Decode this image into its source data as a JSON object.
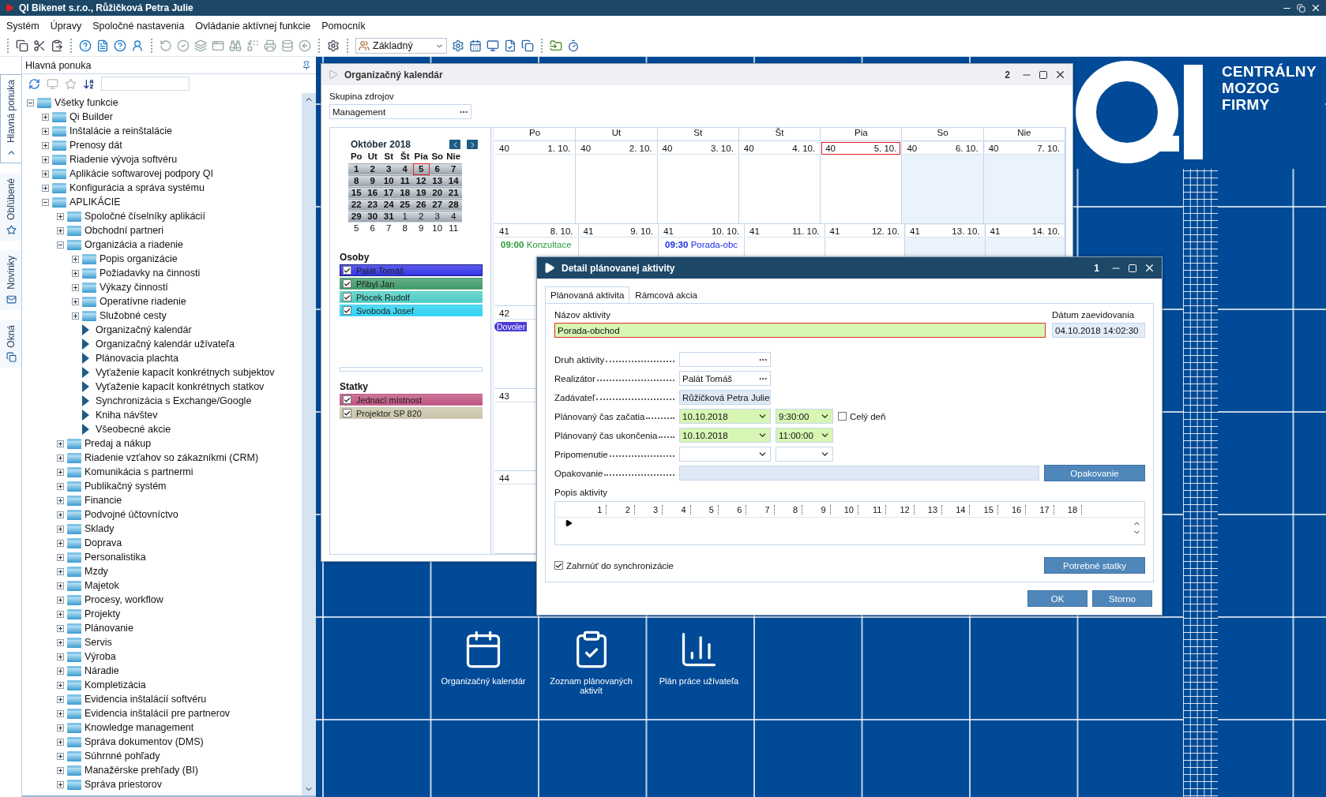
{
  "window": {
    "title": "QI  Bikenet s.r.o., Růžičková Petra Julie"
  },
  "menu": [
    "Systém",
    "Úpravy",
    "Spoločné nastavenia",
    "Ovládanie aktívnej funkcie",
    "Pomocník"
  ],
  "toolbar": {
    "profile": "Základný"
  },
  "sidebar": {
    "tabs": [
      {
        "label": "Hlavná ponuka",
        "selected": true
      },
      {
        "label": "Obľúbené",
        "selected": false
      },
      {
        "label": "Novinky",
        "selected": false
      },
      {
        "label": "Okná",
        "selected": false
      }
    ],
    "title": "Hlavná ponuka",
    "tree": [
      {
        "label": "Všetky funkcie",
        "kind": "folder",
        "expanded": true,
        "children": [
          {
            "label": "Qi Builder",
            "kind": "folder",
            "expanded": false
          },
          {
            "label": "Inštalácie a reinštalácie",
            "kind": "folder",
            "expanded": false
          },
          {
            "label": "Prenosy dát",
            "kind": "folder",
            "expanded": false
          },
          {
            "label": "Riadenie vývoja softvéru",
            "kind": "folder",
            "expanded": false
          },
          {
            "label": "Aplikácie softwarovej podpory QI",
            "kind": "folder",
            "expanded": false
          },
          {
            "label": "Konfigurácia a správa systému",
            "kind": "folder",
            "expanded": false
          },
          {
            "label": "APLIKÁCIE",
            "kind": "folder",
            "expanded": true,
            "children": [
              {
                "label": "Spoločné číselníky aplikácií",
                "kind": "folder",
                "expanded": false
              },
              {
                "label": "Obchodní partneri",
                "kind": "folder",
                "expanded": false
              },
              {
                "label": "Organizácia a riadenie",
                "kind": "folder",
                "expanded": true,
                "children": [
                  {
                    "label": "Popis organizácie",
                    "kind": "folder",
                    "expanded": false
                  },
                  {
                    "label": "Požiadavky na činnosti",
                    "kind": "folder",
                    "expanded": false
                  },
                  {
                    "label": "Výkazy činností",
                    "kind": "folder",
                    "expanded": false
                  },
                  {
                    "label": "Operatívne riadenie",
                    "kind": "folder",
                    "expanded": false
                  },
                  {
                    "label": "Služobné cesty",
                    "kind": "folder",
                    "expanded": false
                  },
                  {
                    "label": "Organizačný kalendár",
                    "kind": "function"
                  },
                  {
                    "label": "Organizačný kalendár užívateľa",
                    "kind": "function"
                  },
                  {
                    "label": "Plánovacia plachta",
                    "kind": "function"
                  },
                  {
                    "label": "Vyťaženie kapacít konkrétnych subjektov",
                    "kind": "function"
                  },
                  {
                    "label": "Vyťaženie kapacít konkrétnych statkov",
                    "kind": "function"
                  },
                  {
                    "label": "Synchronizácia s Exchange/Google",
                    "kind": "function"
                  },
                  {
                    "label": "Kniha návštev",
                    "kind": "function"
                  },
                  {
                    "label": "Všeobecné akcie",
                    "kind": "function"
                  }
                ]
              },
              {
                "label": "Predaj a nákup",
                "kind": "folder",
                "expanded": false
              },
              {
                "label": "Riadenie vzťahov so zákazníkmi (CRM)",
                "kind": "folder",
                "expanded": false
              },
              {
                "label": "Komunikácia s partnermi",
                "kind": "folder",
                "expanded": false
              },
              {
                "label": "Publikačný systém",
                "kind": "folder",
                "expanded": false
              },
              {
                "label": "Financie",
                "kind": "folder",
                "expanded": false
              },
              {
                "label": "Podvojné účtovníctvo",
                "kind": "folder",
                "expanded": false
              },
              {
                "label": "Sklady",
                "kind": "folder",
                "expanded": false
              },
              {
                "label": "Doprava",
                "kind": "folder",
                "expanded": false
              },
              {
                "label": "Personalistika",
                "kind": "folder",
                "expanded": false
              },
              {
                "label": "Mzdy",
                "kind": "folder",
                "expanded": false
              },
              {
                "label": "Majetok",
                "kind": "folder",
                "expanded": false
              },
              {
                "label": "Procesy, workflow",
                "kind": "folder",
                "expanded": false
              },
              {
                "label": "Projekty",
                "kind": "folder",
                "expanded": false
              },
              {
                "label": "Plánovanie",
                "kind": "folder",
                "expanded": false
              },
              {
                "label": "Servis",
                "kind": "folder",
                "expanded": false
              },
              {
                "label": "Výroba",
                "kind": "folder",
                "expanded": false
              },
              {
                "label": "Náradie",
                "kind": "folder",
                "expanded": false
              },
              {
                "label": "Kompletizácia",
                "kind": "folder",
                "expanded": false
              },
              {
                "label": "Evidencia inštalácií softvéru",
                "kind": "folder",
                "expanded": false
              },
              {
                "label": "Evidencia inštalácií pre partnerov",
                "kind": "folder",
                "expanded": false
              },
              {
                "label": "Knowledge management",
                "kind": "folder",
                "expanded": false
              },
              {
                "label": "Správa dokumentov (DMS)",
                "kind": "folder",
                "expanded": false
              },
              {
                "label": "Súhrnné pohľady",
                "kind": "folder",
                "expanded": false
              },
              {
                "label": "Manažérske prehľady (BI)",
                "kind": "folder",
                "expanded": false
              },
              {
                "label": "Správa priestorov",
                "kind": "folder",
                "expanded": false
              }
            ]
          }
        ]
      }
    ]
  },
  "calendar_window": {
    "title": "Organizačný kalendár",
    "number": "2",
    "group_label": "Skupina zdrojov",
    "group_value": "Management",
    "mini_calendar": {
      "title": "Október 2018",
      "weekdays": [
        "Po",
        "Ut",
        "St",
        "Št",
        "Pia",
        "So",
        "Nie"
      ],
      "weeks": [
        [
          {
            "day": "1",
            "in_month": true,
            "today": false
          },
          {
            "day": "2",
            "in_month": true,
            "today": false
          },
          {
            "day": "3",
            "in_month": true,
            "today": false
          },
          {
            "day": "4",
            "in_month": true,
            "today": false
          },
          {
            "day": "5",
            "in_month": true,
            "today": true
          },
          {
            "day": "6",
            "in_month": true,
            "today": false
          },
          {
            "day": "7",
            "in_month": true,
            "today": false
          }
        ],
        [
          {
            "day": "8",
            "in_month": true,
            "today": false
          },
          {
            "day": "9",
            "in_month": true,
            "today": false
          },
          {
            "day": "10",
            "in_month": true,
            "today": false
          },
          {
            "day": "11",
            "in_month": true,
            "today": false
          },
          {
            "day": "12",
            "in_month": true,
            "today": false
          },
          {
            "day": "13",
            "in_month": true,
            "today": false
          },
          {
            "day": "14",
            "in_month": true,
            "today": false
          }
        ],
        [
          {
            "day": "15",
            "in_month": true,
            "today": false
          },
          {
            "day": "16",
            "in_month": true,
            "today": false
          },
          {
            "day": "17",
            "in_month": true,
            "today": false
          },
          {
            "day": "18",
            "in_month": true,
            "today": false
          },
          {
            "day": "19",
            "in_month": true,
            "today": false
          },
          {
            "day": "20",
            "in_month": true,
            "today": false
          },
          {
            "day": "21",
            "in_month": true,
            "today": false
          }
        ],
        [
          {
            "day": "22",
            "in_month": true,
            "today": false
          },
          {
            "day": "23",
            "in_month": true,
            "today": false
          },
          {
            "day": "24",
            "in_month": true,
            "today": false
          },
          {
            "day": "25",
            "in_month": true,
            "today": false
          },
          {
            "day": "26",
            "in_month": true,
            "today": false
          },
          {
            "day": "27",
            "in_month": true,
            "today": false
          },
          {
            "day": "28",
            "in_month": true,
            "today": false
          }
        ],
        [
          {
            "day": "29",
            "in_month": true,
            "today": false
          },
          {
            "day": "30",
            "in_month": true,
            "today": false
          },
          {
            "day": "31",
            "in_month": true,
            "today": false
          },
          {
            "day": "1",
            "in_month": false,
            "today": false
          },
          {
            "day": "2",
            "in_month": false,
            "today": false
          },
          {
            "day": "3",
            "in_month": false,
            "today": false
          },
          {
            "day": "4",
            "in_month": false,
            "today": false
          }
        ],
        [
          {
            "day": "5",
            "in_month": false,
            "today": false
          },
          {
            "day": "6",
            "in_month": false,
            "today": false
          },
          {
            "day": "7",
            "in_month": false,
            "today": false
          },
          {
            "day": "8",
            "in_month": false,
            "today": false
          },
          {
            "day": "9",
            "in_month": false,
            "today": false
          },
          {
            "day": "10",
            "in_month": false,
            "today": false
          },
          {
            "day": "11",
            "in_month": false,
            "today": false
          }
        ]
      ]
    },
    "people_label": "Osoby",
    "people": [
      {
        "name": "Palát Tomáš",
        "checked": true,
        "selected": true,
        "color": "#3434e8"
      },
      {
        "name": "Přibyl Jan",
        "checked": true,
        "selected": false,
        "color": "#3f9a68"
      },
      {
        "name": "Plocek Rudolf",
        "checked": true,
        "selected": false,
        "color": "#4ccdc4"
      },
      {
        "name": "Svoboda Josef",
        "checked": true,
        "selected": false,
        "color": "#2ed2f2"
      }
    ],
    "resources_label": "Statky",
    "resources": [
      {
        "name": "Jednací místnost",
        "checked": true,
        "color": "#c05482"
      },
      {
        "name": "Projektor SP 820",
        "checked": true,
        "color": "#c9c5aa"
      }
    ],
    "days": [
      {
        "label": "Po",
        "weekend": false
      },
      {
        "label": "Ut",
        "weekend": false
      },
      {
        "label": "St",
        "weekend": false
      },
      {
        "label": "Št",
        "weekend": false
      },
      {
        "label": "Pia",
        "weekend": false
      },
      {
        "label": "So",
        "weekend": true
      },
      {
        "label": "Nie",
        "weekend": true
      }
    ],
    "weeks": [
      {
        "cells": [
          {
            "week": "40",
            "date": "1. 10.",
            "today": false
          },
          {
            "week": "40",
            "date": "2. 10.",
            "today": false
          },
          {
            "week": "40",
            "date": "3. 10.",
            "today": false
          },
          {
            "week": "40",
            "date": "4. 10.",
            "today": false
          },
          {
            "week": "40",
            "date": "5. 10.",
            "today": true
          },
          {
            "week": "40",
            "date": "6. 10.",
            "today": false
          },
          {
            "week": "40",
            "date": "7. 10.",
            "today": false
          }
        ]
      },
      {
        "cells": [
          {
            "week": "41",
            "date": "8. 10.",
            "today": false,
            "events": [
              {
                "kind": "timed",
                "time": "09:00",
                "title": "Konzultace",
                "color": "#2a9a3a"
              }
            ]
          },
          {
            "week": "41",
            "date": "9. 10.",
            "today": false
          },
          {
            "week": "41",
            "date": "10. 10.",
            "today": false,
            "events": [
              {
                "kind": "timed",
                "time": "09:30",
                "title": "Porada-obc",
                "color": "#1a2ee0"
              }
            ]
          },
          {
            "week": "41",
            "date": "11. 10.",
            "today": false
          },
          {
            "week": "41",
            "date": "12. 10.",
            "today": false
          },
          {
            "week": "41",
            "date": "13. 10.",
            "today": false
          },
          {
            "week": "41",
            "date": "14. 10.",
            "today": false
          }
        ]
      },
      {
        "cells": [
          {
            "week": "42",
            "events": [
              {
                "kind": "bar",
                "title": "Dovoler",
                "color": "#4a3ad8"
              }
            ]
          }
        ]
      },
      {
        "cells": [
          {
            "week": "43"
          }
        ]
      },
      {
        "cells": [
          {
            "week": "44"
          }
        ]
      }
    ]
  },
  "dialog": {
    "title": "Detail plánovanej aktivity",
    "number": "1",
    "tabs": [
      {
        "label": "Plánovaná aktivita",
        "selected": true
      },
      {
        "label": "Rámcová akcia",
        "selected": false
      }
    ],
    "name_label": "Názov aktivity",
    "name_value": "Porada-obchod",
    "recorded_label": "Dátum zaevidovania",
    "recorded_value": "04.10.2018 14:02:30",
    "fields": [
      {
        "kind": "lookup",
        "label": "Druh aktivity"
      },
      {
        "kind": "lookup",
        "label": "Realizátor",
        "value": "Palát Tomáš"
      },
      {
        "kind": "readonly",
        "label": "Zadávateľ",
        "value": "Růžičková Petra Julie"
      },
      {
        "kind": "datetime",
        "label": "Plánovaný čas začatia",
        "date": "10.10.2018",
        "time": "9:30:00",
        "all_day": {
          "label": "Celý deň",
          "checked": false
        }
      },
      {
        "kind": "datetime",
        "label": "Plánovaný čas ukončenia",
        "date": "10.10.2018",
        "time": "11:00:00"
      },
      {
        "kind": "datetime",
        "label": "Pripomenutie"
      },
      {
        "kind": "action",
        "label": "Opakovanie",
        "button": "Opakovanie"
      }
    ],
    "description_label": "Popis aktivity",
    "ruler": [
      "1",
      "2",
      "3",
      "4",
      "5",
      "6",
      "7",
      "8",
      "9",
      "10",
      "11",
      "12",
      "13",
      "14",
      "15",
      "16",
      "17",
      "18"
    ],
    "sync": {
      "label": "Zahrnúť do synchronizácie",
      "checked": true
    },
    "resources_button": "Potrebné statky",
    "buttons": [
      "OK",
      "Storno"
    ]
  },
  "logo": {
    "lines": [
      "CENTRÁLNY",
      "MOZOG",
      "FIRMY"
    ]
  },
  "shortcuts": [
    {
      "kind": "calendar",
      "label": "Organizačný kalendár"
    },
    {
      "kind": "checklist",
      "label": "Zoznam plánovaných aktivít"
    },
    {
      "kind": "chart",
      "label": "Plán práce užívateľa"
    }
  ]
}
